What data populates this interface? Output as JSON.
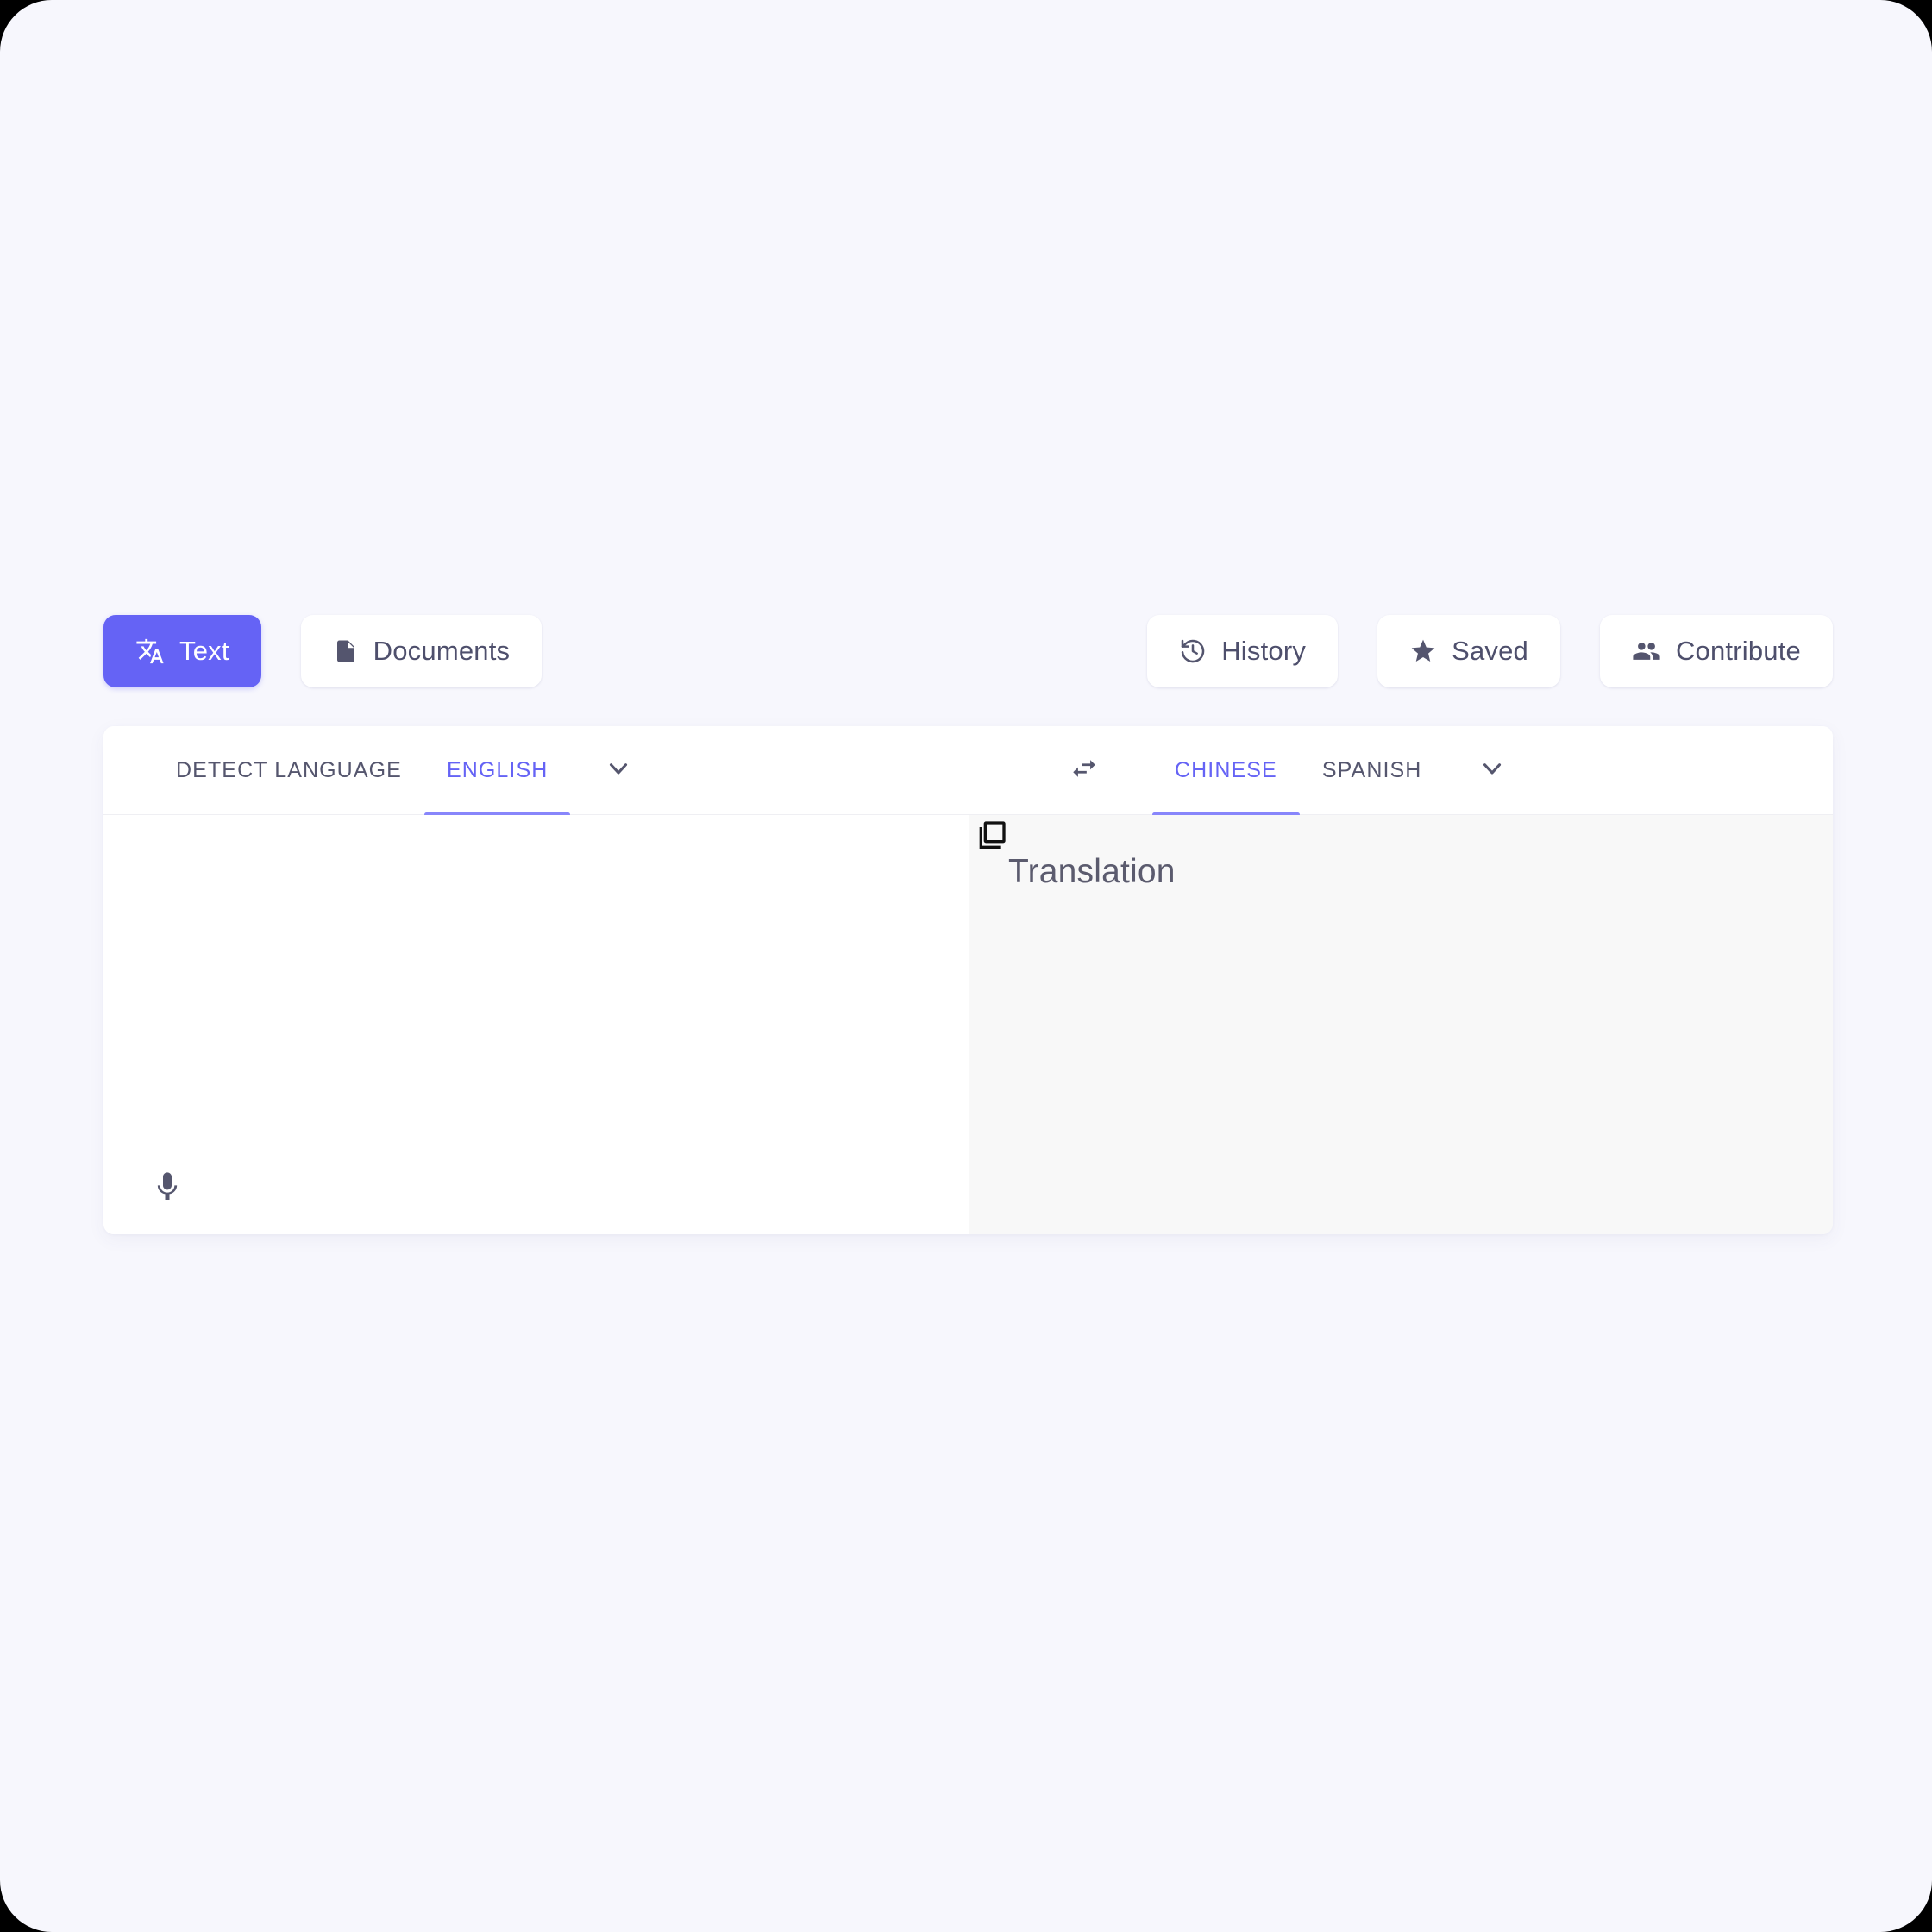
{
  "theme": {
    "page_background": "#F7F7FD",
    "card_background": "#FFFFFF",
    "target_pane_background": "#F8F8F8",
    "accent": "#6563F5",
    "accent_underline": "#8886FB",
    "text_primary": "#4E4F6C",
    "text_muted": "#55566E"
  },
  "toolbar": {
    "left_items": [
      {
        "label": "Text",
        "icon": "translate-icon",
        "active": true
      },
      {
        "label": "Documents",
        "icon": "document-icon",
        "active": false
      }
    ],
    "right_items": [
      {
        "label": "History",
        "icon": "history-icon"
      },
      {
        "label": "Saved",
        "icon": "star-icon"
      },
      {
        "label": "Contribute",
        "icon": "people-icon"
      }
    ]
  },
  "card": {
    "source": {
      "options": [
        {
          "label": "DETECT LANGUAGE",
          "active": false
        },
        {
          "label": "ENGLISH",
          "active": true
        }
      ],
      "chevron_icon": "chevron-down-icon",
      "textarea_value": "",
      "textarea_placeholder": "",
      "mic_icon": "microphone-icon"
    },
    "swap": {
      "icon": "swap-horizontal-icon"
    },
    "target": {
      "options": [
        {
          "label": "CHINESE",
          "active": true
        },
        {
          "label": "SPANISH",
          "active": false
        }
      ],
      "chevron_icon": "chevron-down-icon",
      "placeholder": "Translation",
      "copy_icon": "copy-icon"
    }
  }
}
